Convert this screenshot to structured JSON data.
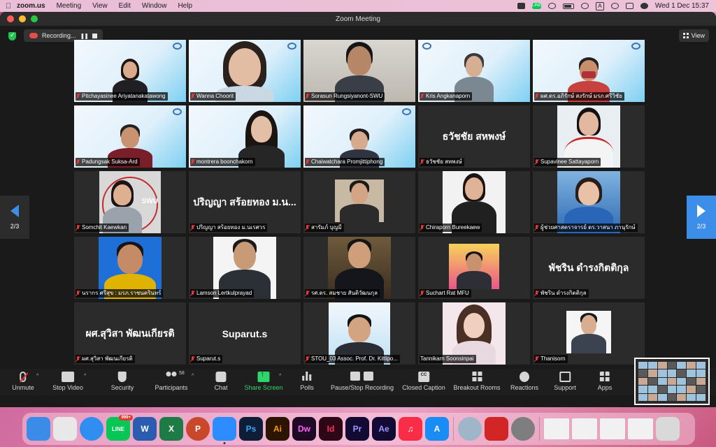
{
  "menubar": {
    "app": "zoom.us",
    "items": [
      "Meeting",
      "View",
      "Edit",
      "Window",
      "Help"
    ],
    "clock": "Wed 1 Dec  15:37",
    "status_icons": [
      "video-icon",
      "line-icon",
      "cast-icon",
      "battery-icon",
      "wifi-icon",
      "input-a-icon",
      "search-icon",
      "control-center-icon",
      "siri-icon"
    ],
    "input_letter": "A",
    "line_label": "LINE"
  },
  "window": {
    "title": "Zoom Meeting",
    "recording_label": "Recording...",
    "view_label": "View"
  },
  "pagination": {
    "left": "2/3",
    "right": "2/3"
  },
  "participants": [
    {
      "name": "Pitchayasinee Ariyatanakatawong",
      "type": "slide"
    },
    {
      "name": "Wanna Choorit",
      "type": "slide"
    },
    {
      "name": "Sorasun Rungsiyanont-SWU",
      "type": "room"
    },
    {
      "name": "Kris Angkanaporn",
      "type": "slide"
    },
    {
      "name": "ผศ.ดร.อภิรักษ์ สงรักษ์  มรภ.ศรีวิชัย",
      "type": "slide"
    },
    {
      "name": "Padungsak Suksa-Ard",
      "type": "slide"
    },
    {
      "name": "montrera boonchakorn",
      "type": "slide"
    },
    {
      "name": "Chaiwatchara Promjittiphong",
      "type": "slide"
    },
    {
      "name": "ธวัชชัย สหพงษ์",
      "type": "text",
      "display": "ธวัชชัย สหพงษ์"
    },
    {
      "name": "Supavinee Sattayaporn",
      "type": "photo"
    },
    {
      "name": "Somchit Kaewkan",
      "type": "photo",
      "logo_text": "SWU"
    },
    {
      "name": "ปริญญา สร้อยทอง ม.นเรศวร",
      "type": "text",
      "display": "ปริญญา สร้อยทอง ม.น..."
    },
    {
      "name": "สารัมภ์ บุญมี",
      "type": "photo"
    },
    {
      "name": "Chiraporn Bureekaew",
      "type": "photo"
    },
    {
      "name": "ผู้ช่วยศาสตราจารย์ ดร.วาสนา ภานุรักษ์",
      "type": "photo"
    },
    {
      "name": "นรากร ศรีสุข : มรภ.ราชนครินทร์",
      "type": "photo"
    },
    {
      "name": "Lamson Lertkulprayad",
      "type": "photo"
    },
    {
      "name": "รศ.ดร. สมชาย สันติวัฒนกุล",
      "type": "photo"
    },
    {
      "name": "Suchart Rat MFU",
      "type": "photo"
    },
    {
      "name": "พัชริน ดำรงกิตติกุล",
      "type": "text",
      "display": "พัชริน ดำรงกิตติกุล"
    },
    {
      "name": "ผศ.สุวิสา พัฒนเกียรติ",
      "type": "text",
      "display": "ผศ.สุวิสา พัฒนเกียรติ"
    },
    {
      "name": "Suparut.s",
      "type": "text",
      "display": "Suparut.s"
    },
    {
      "name": "STOU_03 Assoc. Prof. Dr. Kittipo...",
      "type": "photo"
    },
    {
      "name": "Tannikarn Soonsinpai",
      "type": "photo"
    },
    {
      "name": "Thanisorn",
      "type": "photo"
    }
  ],
  "toolbar": {
    "unmute": "Unmute",
    "stop_video": "Stop Video",
    "security": "Security",
    "participants": "Participants",
    "participants_count": "58",
    "chat": "Chat",
    "share_screen": "Share Screen",
    "polls": "Polls",
    "pause_stop_recording": "Pause/Stop Recording",
    "closed_caption": "Closed Caption",
    "cc_glyph": "CC",
    "breakout_rooms": "Breakout Rooms",
    "reactions": "Reactions",
    "support": "Support",
    "apps": "Apps"
  },
  "dock": {
    "apps": [
      {
        "name": "finder-icon",
        "color": "#3b8be8",
        "label": ""
      },
      {
        "name": "launchpad-icon",
        "color": "#e8e8e8",
        "label": ""
      },
      {
        "name": "safari-icon",
        "color": "#2f8ef0",
        "label": ""
      },
      {
        "name": "line-app-icon",
        "color": "#06c755",
        "label": "LINE",
        "badge": "999+"
      },
      {
        "name": "word-icon",
        "color": "#2b5caf",
        "label": "W"
      },
      {
        "name": "excel-icon",
        "color": "#1e7b45",
        "label": "X"
      },
      {
        "name": "powerpoint-icon",
        "color": "#c9472a",
        "label": "P"
      },
      {
        "name": "zoom-icon",
        "color": "#2d8cff",
        "label": ""
      },
      {
        "name": "photoshop-icon",
        "color": "#0f1e37",
        "label": "Ps"
      },
      {
        "name": "illustrator-icon",
        "color": "#2b1400",
        "label": "Ai"
      },
      {
        "name": "dreamweaver-icon",
        "color": "#1e0a24",
        "label": "Dw"
      },
      {
        "name": "indesign-icon",
        "color": "#2d0716",
        "label": "Id"
      },
      {
        "name": "premiere-icon",
        "color": "#120a33",
        "label": "Pr"
      },
      {
        "name": "after-effects-icon",
        "color": "#120a33",
        "label": "Ae"
      },
      {
        "name": "music-icon",
        "color": "#fa2d48",
        "label": "♫"
      },
      {
        "name": "app-store-icon",
        "color": "#1a8cf5",
        "label": "A"
      },
      {
        "name": "quicktime-icon",
        "color": "#9fb6c8",
        "label": ""
      },
      {
        "name": "acrobat-icon",
        "color": "#d22525",
        "label": ""
      },
      {
        "name": "system-preferences-icon",
        "color": "#7e7e7e",
        "label": ""
      },
      {
        "name": "trash-icon",
        "color": "#d9d9d9",
        "label": ""
      }
    ]
  }
}
